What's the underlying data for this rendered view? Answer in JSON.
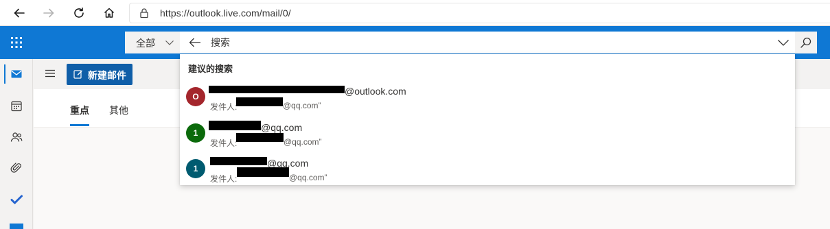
{
  "browser": {
    "url": "https://outlook.live.com/mail/0/"
  },
  "header": {
    "search": {
      "scope_label": "全部",
      "placeholder": "搜索"
    }
  },
  "command_bar": {
    "new_mail_label": "新建邮件"
  },
  "tabs": [
    {
      "label": "重点",
      "active": true
    },
    {
      "label": "其他",
      "active": false
    }
  ],
  "suggestions": {
    "heading": "建议的搜索",
    "items": [
      {
        "avatar_letter": "O",
        "avatar_color": "#a4262c",
        "address_suffix": "@outlook.com",
        "from_prefix": "发件人:",
        "from_suffix": "@qq.com”"
      },
      {
        "avatar_letter": "1",
        "avatar_color": "#0b6a0b",
        "address_suffix": "@qq.com",
        "from_prefix": "发件人:",
        "from_suffix": "@qq.com”"
      },
      {
        "avatar_letter": "1",
        "avatar_color": "#005b70",
        "address_suffix": "@qq.com",
        "from_prefix": "发件人:",
        "from_suffix": "@qq.com”"
      }
    ]
  },
  "rail": {
    "items": [
      {
        "icon": "mail-icon",
        "active": true
      },
      {
        "icon": "calendar-icon",
        "active": false
      },
      {
        "icon": "people-icon",
        "active": false
      },
      {
        "icon": "attachment-icon",
        "active": false
      },
      {
        "icon": "todo-icon",
        "active": false
      }
    ]
  },
  "colors": {
    "brand": "#0f78d4",
    "new_mail_button": "#0f5ea8"
  }
}
